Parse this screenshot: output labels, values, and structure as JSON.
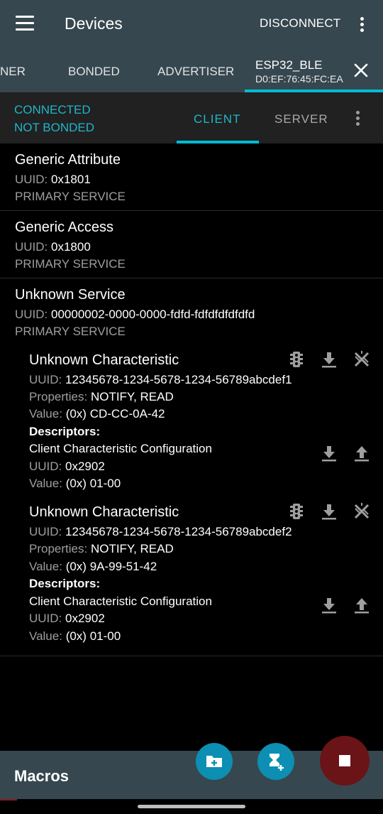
{
  "app_bar": {
    "title": "Devices",
    "disconnect_label": "DISCONNECT",
    "menu_icon": "hamburger-menu-icon",
    "more_icon": "overflow-menu-icon"
  },
  "device_tabs": {
    "tabs": [
      "NER",
      "BONDED",
      "ADVERTISER"
    ],
    "active": {
      "name": "ESP32_BLE",
      "address": "D0:EF:76:45:FC:EA"
    },
    "close_icon": "close-icon"
  },
  "status": {
    "connection": "CONNECTED",
    "bond": "NOT BONDED",
    "tabs": [
      "CLIENT",
      "SERVER"
    ],
    "active_tab": "CLIENT"
  },
  "services": [
    {
      "name": "Generic Attribute",
      "uuid_label": "UUID:",
      "uuid": "0x1801",
      "type": "PRIMARY SERVICE"
    },
    {
      "name": "Generic Access",
      "uuid_label": "UUID:",
      "uuid": "0x1800",
      "type": "PRIMARY SERVICE"
    },
    {
      "name": "Unknown Service",
      "uuid_label": "UUID:",
      "uuid": "00000002-0000-0000-fdfd-fdfdfdfdfdfd",
      "type": "PRIMARY SERVICE",
      "characteristics": [
        {
          "name": "Unknown Characteristic",
          "uuid_label": "UUID:",
          "uuid": "12345678-1234-5678-1234-56789abcdef1",
          "properties_label": "Properties:",
          "properties": "NOTIFY, READ",
          "value_label": "Value:",
          "value": "(0x) CD-CC-0A-42",
          "descriptors_label": "Descriptors:",
          "descriptor": {
            "name": "Client Characteristic Configuration",
            "uuid_label": "UUID:",
            "uuid": "0x2902",
            "value_label": "Value:",
            "value": "(0x) 01-00"
          }
        },
        {
          "name": "Unknown Characteristic",
          "uuid_label": "UUID:",
          "uuid": "12345678-1234-5678-1234-56789abcdef2",
          "properties_label": "Properties:",
          "properties": "NOTIFY, READ",
          "value_label": "Value:",
          "value": "(0x) 9A-99-51-42",
          "descriptors_label": "Descriptors:",
          "descriptor": {
            "name": "Client Characteristic Configuration",
            "uuid_label": "UUID:",
            "uuid": "0x2902",
            "value_label": "Value:",
            "value": "(0x) 01-00"
          }
        }
      ]
    }
  ],
  "macros": {
    "label": "Macros"
  },
  "colors": {
    "accent": "#20b6c9",
    "app_bar": "#37474f",
    "record_fab": "#6a1418",
    "fab": "#0c8fb2"
  }
}
